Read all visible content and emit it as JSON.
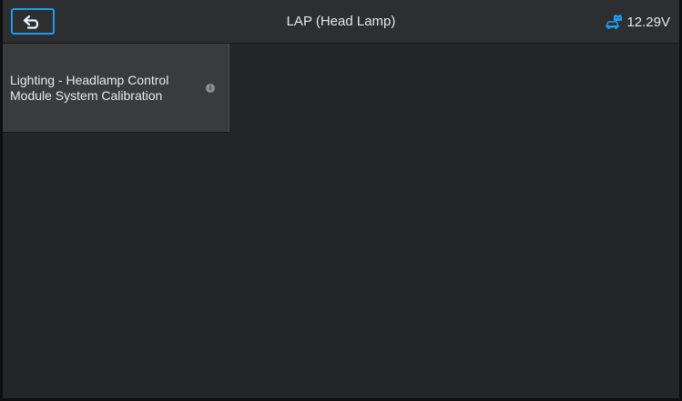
{
  "header": {
    "title": "LAP (Head Lamp)",
    "voltage": "12.29V",
    "back_icon": "back-arrow-icon",
    "battery_icon": "car-battery-icon"
  },
  "menu": {
    "items": [
      {
        "label_line1": "Lighting - Headlamp Control",
        "label_line2": "Module System Calibration",
        "info_icon": "info-icon",
        "info_glyph": "i"
      }
    ]
  },
  "colors": {
    "accent": "#1e9bf0",
    "background": "#242527",
    "header_bg": "#2d2e30",
    "tile_bg": "#3a3b3d",
    "text": "#e6e6e6"
  }
}
